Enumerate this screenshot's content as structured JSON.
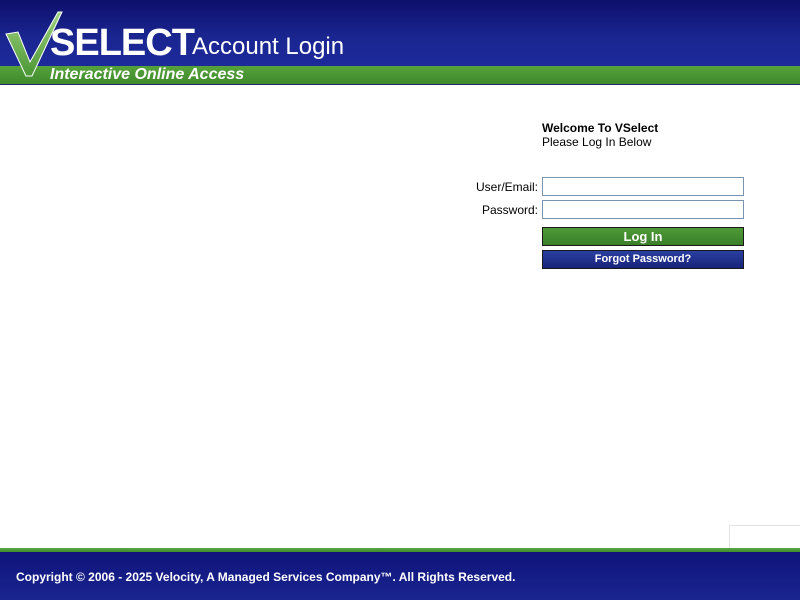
{
  "header": {
    "logo_text": "SELECT",
    "title": "Account Login",
    "subtitle": "Interactive Online Access"
  },
  "welcome": {
    "title": "Welcome To VSelect",
    "subtitle": "Please Log In Below"
  },
  "form": {
    "user_label": "User/Email:",
    "user_value": "",
    "password_label": "Password:",
    "password_value": "",
    "login_label": "Log In",
    "forgot_label": "Forgot Password?"
  },
  "footer": {
    "copyright": "Copyright © 2006 - 2025 Velocity, A Managed Services Company™. All Rights Reserved."
  },
  "colors": {
    "header_blue": "#1a2590",
    "header_green": "#4a9634",
    "login_button": "#3f8a2b",
    "forgot_button": "#1c2a8a"
  }
}
